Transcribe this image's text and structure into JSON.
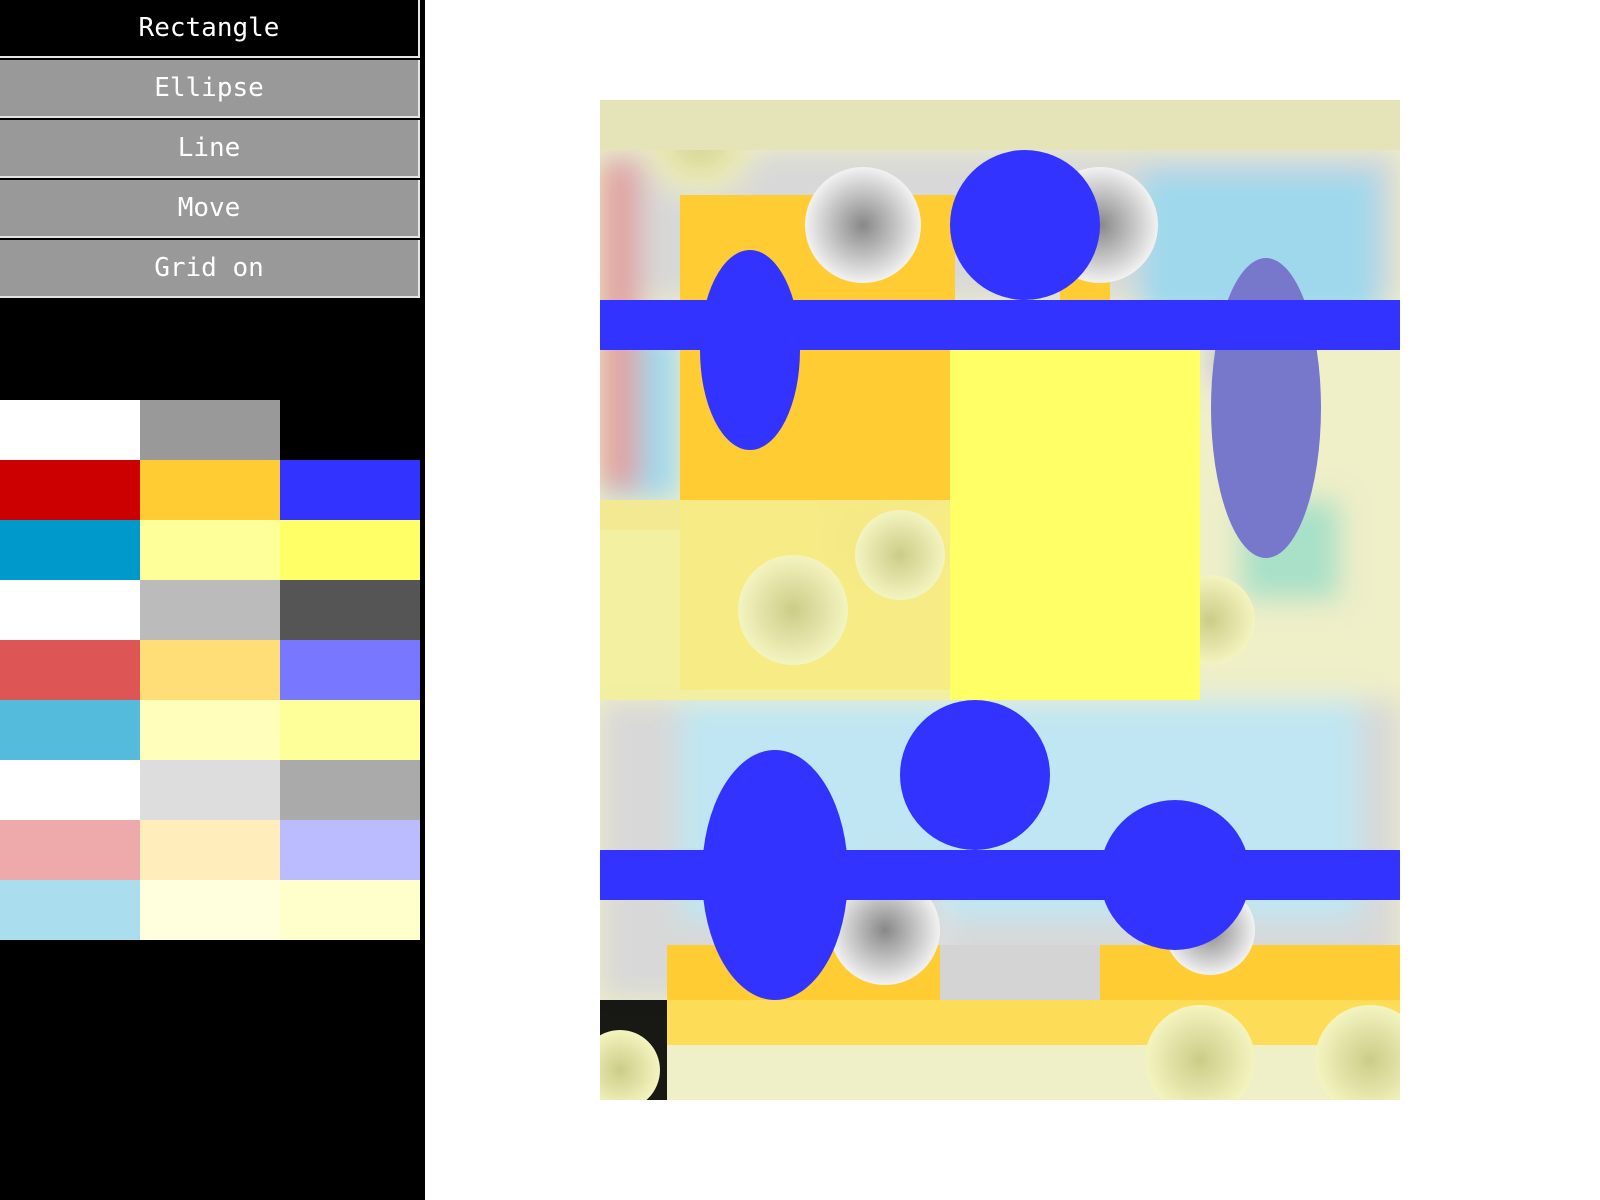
{
  "toolbar": {
    "tools": [
      {
        "label": "Rectangle",
        "active": true
      },
      {
        "label": "Ellipse",
        "active": false
      },
      {
        "label": "Line",
        "active": false
      },
      {
        "label": "Move",
        "active": false
      },
      {
        "label": "Grid on",
        "active": false
      }
    ]
  },
  "palette": {
    "colors": [
      "#ffffff",
      "#999999",
      "#000000",
      "#cc0000",
      "#ffcc33",
      "#3333ff",
      "#0099cc",
      "#ffff99",
      "#ffff66",
      "#ffffff",
      "#bbbbbb",
      "#555555",
      "#dd5555",
      "#ffdd77",
      "#7777ff",
      "#55bbdd",
      "#ffffbb",
      "#ffff99",
      "#ffffff",
      "#dddddd",
      "#aaaaaa",
      "#eeaaaa",
      "#ffeebb",
      "#bbbbff",
      "#aaddee",
      "#ffffdd",
      "#ffffcc"
    ]
  },
  "drawing": {
    "shape_color": "#3333ff",
    "fill_color": "#ffff66",
    "background_colors": [
      "#efefc8",
      "#e0e0e0",
      "#ffcc33",
      "#9fd8ec",
      "#cccccc"
    ]
  }
}
